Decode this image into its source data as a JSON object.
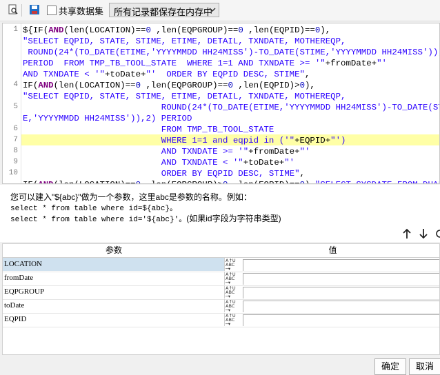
{
  "toolbar": {
    "share_label": "共享数据集",
    "select_value": "所有记录都保存在内存中",
    "icons": [
      "preview-icon",
      "save-icon",
      "chevron-down-icon"
    ]
  },
  "editor": {
    "highlight_line": 7,
    "line_numbers": [
      "1",
      "",
      "",
      "",
      "4",
      "",
      "5",
      "6",
      "7",
      "8",
      "9",
      "10"
    ]
  },
  "hint": {
    "line1": "您可以建入\"${abc}\"做为一个参数，这里abc是参数的名称。例如：",
    "line2": "select * from table where id=${abc}。",
    "line3a": "select * from table where id='${abc}'。",
    "line3b": "(如果id字段为字符串类型)"
  },
  "params": {
    "col_name": "参数",
    "col_value": "值",
    "rows": [
      {
        "name": "LOCATION",
        "value": ""
      },
      {
        "name": "fromDate",
        "value": ""
      },
      {
        "name": "EQPGROUP",
        "value": ""
      },
      {
        "name": "toDate",
        "value": ""
      },
      {
        "name": "EQPID",
        "value": ""
      }
    ],
    "type_icon": "abc-type-icon"
  },
  "buttons": {
    "ok": "确定",
    "cancel": "取消"
  },
  "colors": {
    "keyword": "#7f007f",
    "string": "#2a00ff",
    "number": "#0000c0",
    "highlight": "#ffffa6",
    "selected_row": "#cfe1ef"
  }
}
